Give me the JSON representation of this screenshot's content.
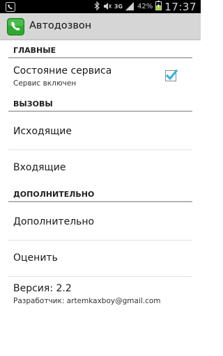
{
  "status_bar": {
    "network": "3G",
    "battery_percent": "42%",
    "time": "17:37",
    "icons": [
      "phone-icon",
      "bluetooth-icon",
      "mute-icon",
      "signal-icon",
      "battery-icon"
    ]
  },
  "action_bar": {
    "app_icon": "phone-icon",
    "title": "Автодозвон"
  },
  "sections": {
    "main": {
      "header": "ГЛАВНЫЕ"
    },
    "calls": {
      "header": "ВЫЗОВЫ"
    },
    "extra": {
      "header": "ДОПОЛНИТЕЛЬНО"
    }
  },
  "service": {
    "title": "Состояние сервиса",
    "summary": "Сервис включен",
    "checked": true
  },
  "outgoing": {
    "title": "Исходящие"
  },
  "incoming": {
    "title": "Входящие"
  },
  "additional": {
    "title": "Дополнительно"
  },
  "rate": {
    "title": "Оценить"
  },
  "version": {
    "title": "Версия: 2.2",
    "summary": "Разработчик: artemkaxboy@gmail.com"
  },
  "colors": {
    "accent": "#33b5e5",
    "app_icon_green": "#2ea82e",
    "action_bar": "#d6d6d6"
  }
}
